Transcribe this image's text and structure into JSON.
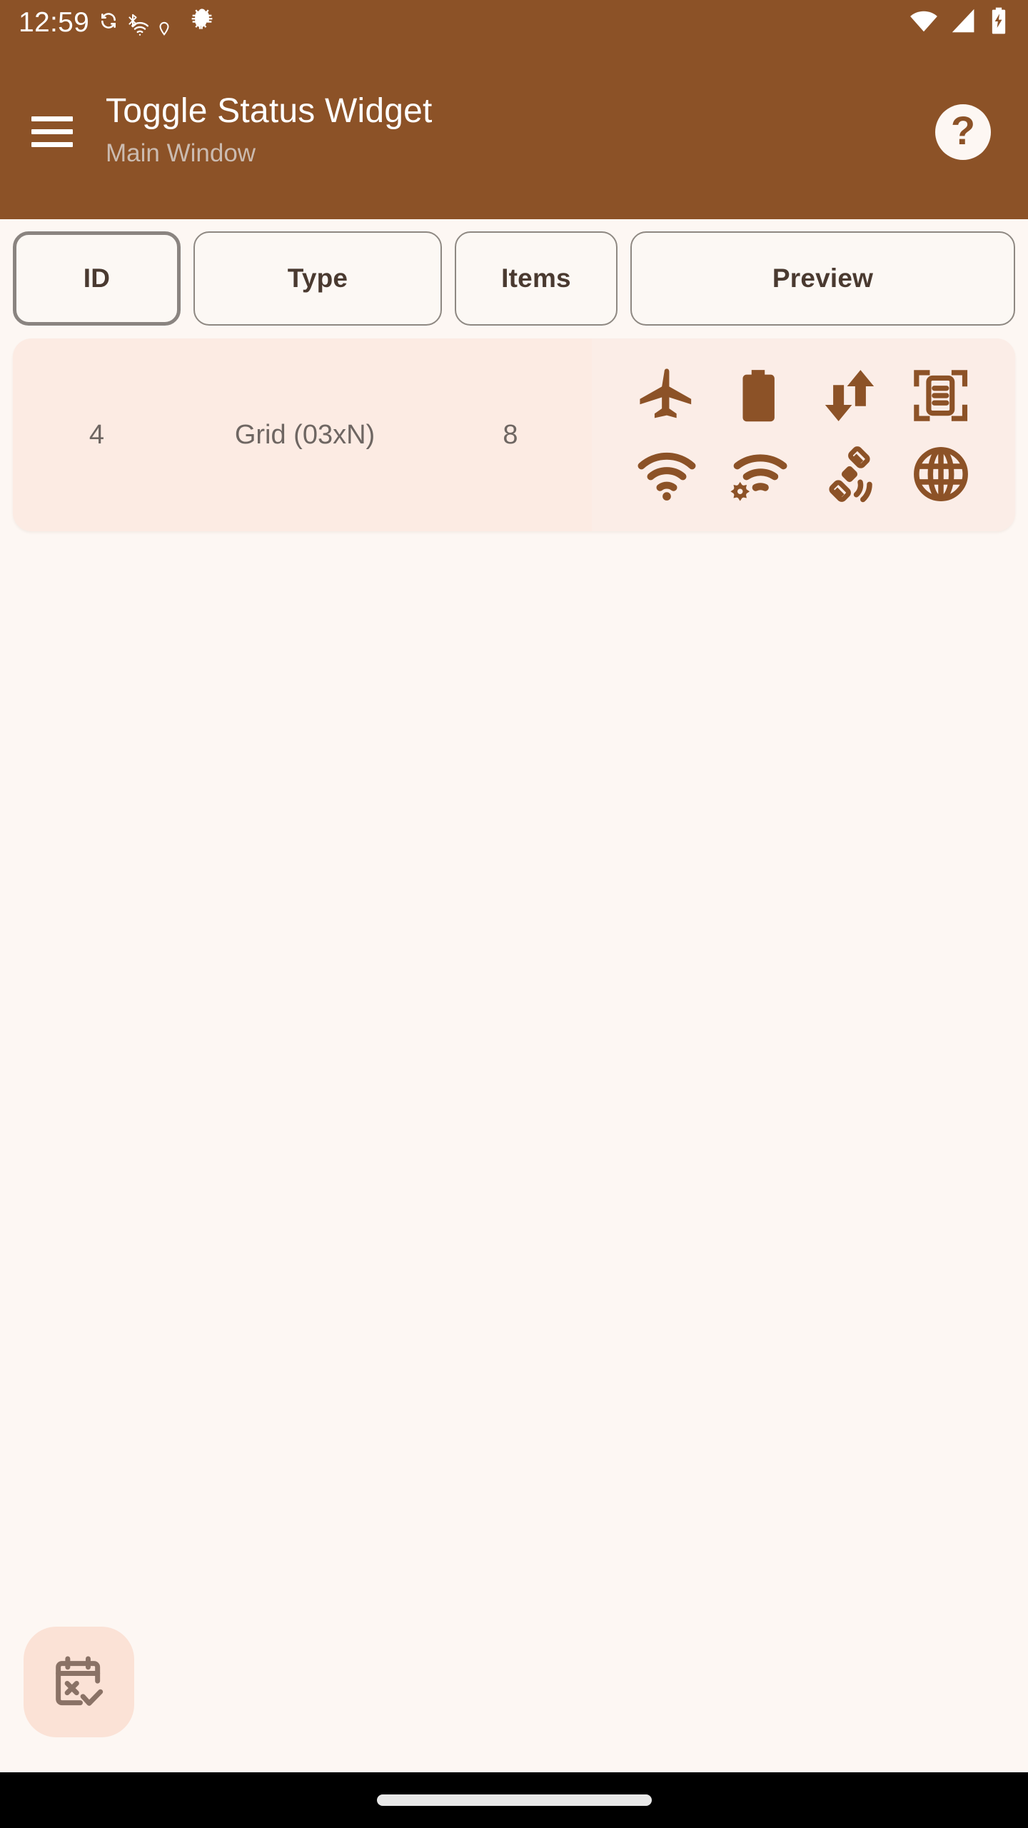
{
  "theme": {
    "brand_brown": "#8C5227",
    "page_bg": "#FDF7F3",
    "row_bg": "#FCEBE3",
    "fab_bg": "#FBE2D6",
    "text_dark": "#4A3A30",
    "text_muted": "#6E6662",
    "subtitle": "#CBBBB0",
    "nav_bar": "#000000"
  },
  "status_bar": {
    "clock": "12:59",
    "left_icons": [
      "sync-icon",
      "bluetooth-icon",
      "wifi-alert-icon",
      "location-icon",
      "bug-icon"
    ],
    "right_icons": [
      "wifi-icon",
      "cellular-signal-icon",
      "battery-charging-icon"
    ]
  },
  "app_bar": {
    "menu_icon": "hamburger-menu-icon",
    "title": "Toggle Status Widget",
    "subtitle": "Main Window",
    "help_icon": "help-circle-icon",
    "help_label": "?"
  },
  "columns": [
    {
      "key": "id",
      "label": "ID",
      "selected": true
    },
    {
      "key": "type",
      "label": "Type",
      "selected": false
    },
    {
      "key": "items",
      "label": "Items",
      "selected": false
    },
    {
      "key": "preview",
      "label": "Preview",
      "selected": false
    }
  ],
  "rows": [
    {
      "id": "4",
      "type": "Grid (03xN)",
      "items": "8",
      "preview_icons": [
        "airplane-mode-icon",
        "battery-icon",
        "data-transfer-icon",
        "scan-document-icon",
        "wifi-icon",
        "wifi-settings-icon",
        "satellite-icon",
        "globe-icon"
      ]
    }
  ],
  "fab": {
    "icon": "calendar-check-x-icon"
  },
  "nav_bar": {
    "gesture_pill": "home-gesture-pill"
  }
}
